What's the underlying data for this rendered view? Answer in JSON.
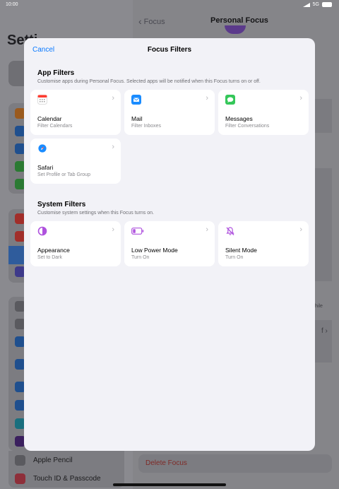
{
  "status_bar": {
    "time": "10:00",
    "network": "5G"
  },
  "sidebar": {
    "title": "Setti",
    "items": [
      {
        "label": "Apple Pencil",
        "icon": "pencil-icon"
      },
      {
        "label": "Touch ID & Passcode",
        "icon": "fingerprint-icon"
      }
    ]
  },
  "detail": {
    "back_label": "Focus",
    "title": "Personal Focus",
    "partial_hint": "hile",
    "partial_value": "f",
    "delete_label": "Delete Focus"
  },
  "modal": {
    "cancel_label": "Cancel",
    "title": "Focus Filters",
    "app_filters": {
      "title": "App Filters",
      "subtitle": "Customise apps during Personal Focus. Selected apps will be notified when this Focus turns on or off.",
      "items": [
        {
          "name": "Calendar",
          "sub": "Filter Calendars",
          "icon": "calendar-icon",
          "color": "#ff3b30"
        },
        {
          "name": "Mail",
          "sub": "Filter Inboxes",
          "icon": "mail-icon",
          "color": "#1a8cff"
        },
        {
          "name": "Messages",
          "sub": "Filter Conversations",
          "icon": "messages-icon",
          "color": "#34c759"
        },
        {
          "name": "Safari",
          "sub": "Set Profile or Tab Group",
          "icon": "safari-icon",
          "color": "#1a8cff"
        }
      ]
    },
    "system_filters": {
      "title": "System Filters",
      "subtitle": "Customise system settings when this Focus turns on.",
      "items": [
        {
          "name": "Appearance",
          "sub": "Set to Dark",
          "icon": "appearance-icon",
          "color": "#af52de"
        },
        {
          "name": "Low Power Mode",
          "sub": "Turn On",
          "icon": "battery-icon",
          "color": "#af52de"
        },
        {
          "name": "Silent Mode",
          "sub": "Turn On",
          "icon": "bell-slash-icon",
          "color": "#af52de"
        }
      ]
    }
  }
}
